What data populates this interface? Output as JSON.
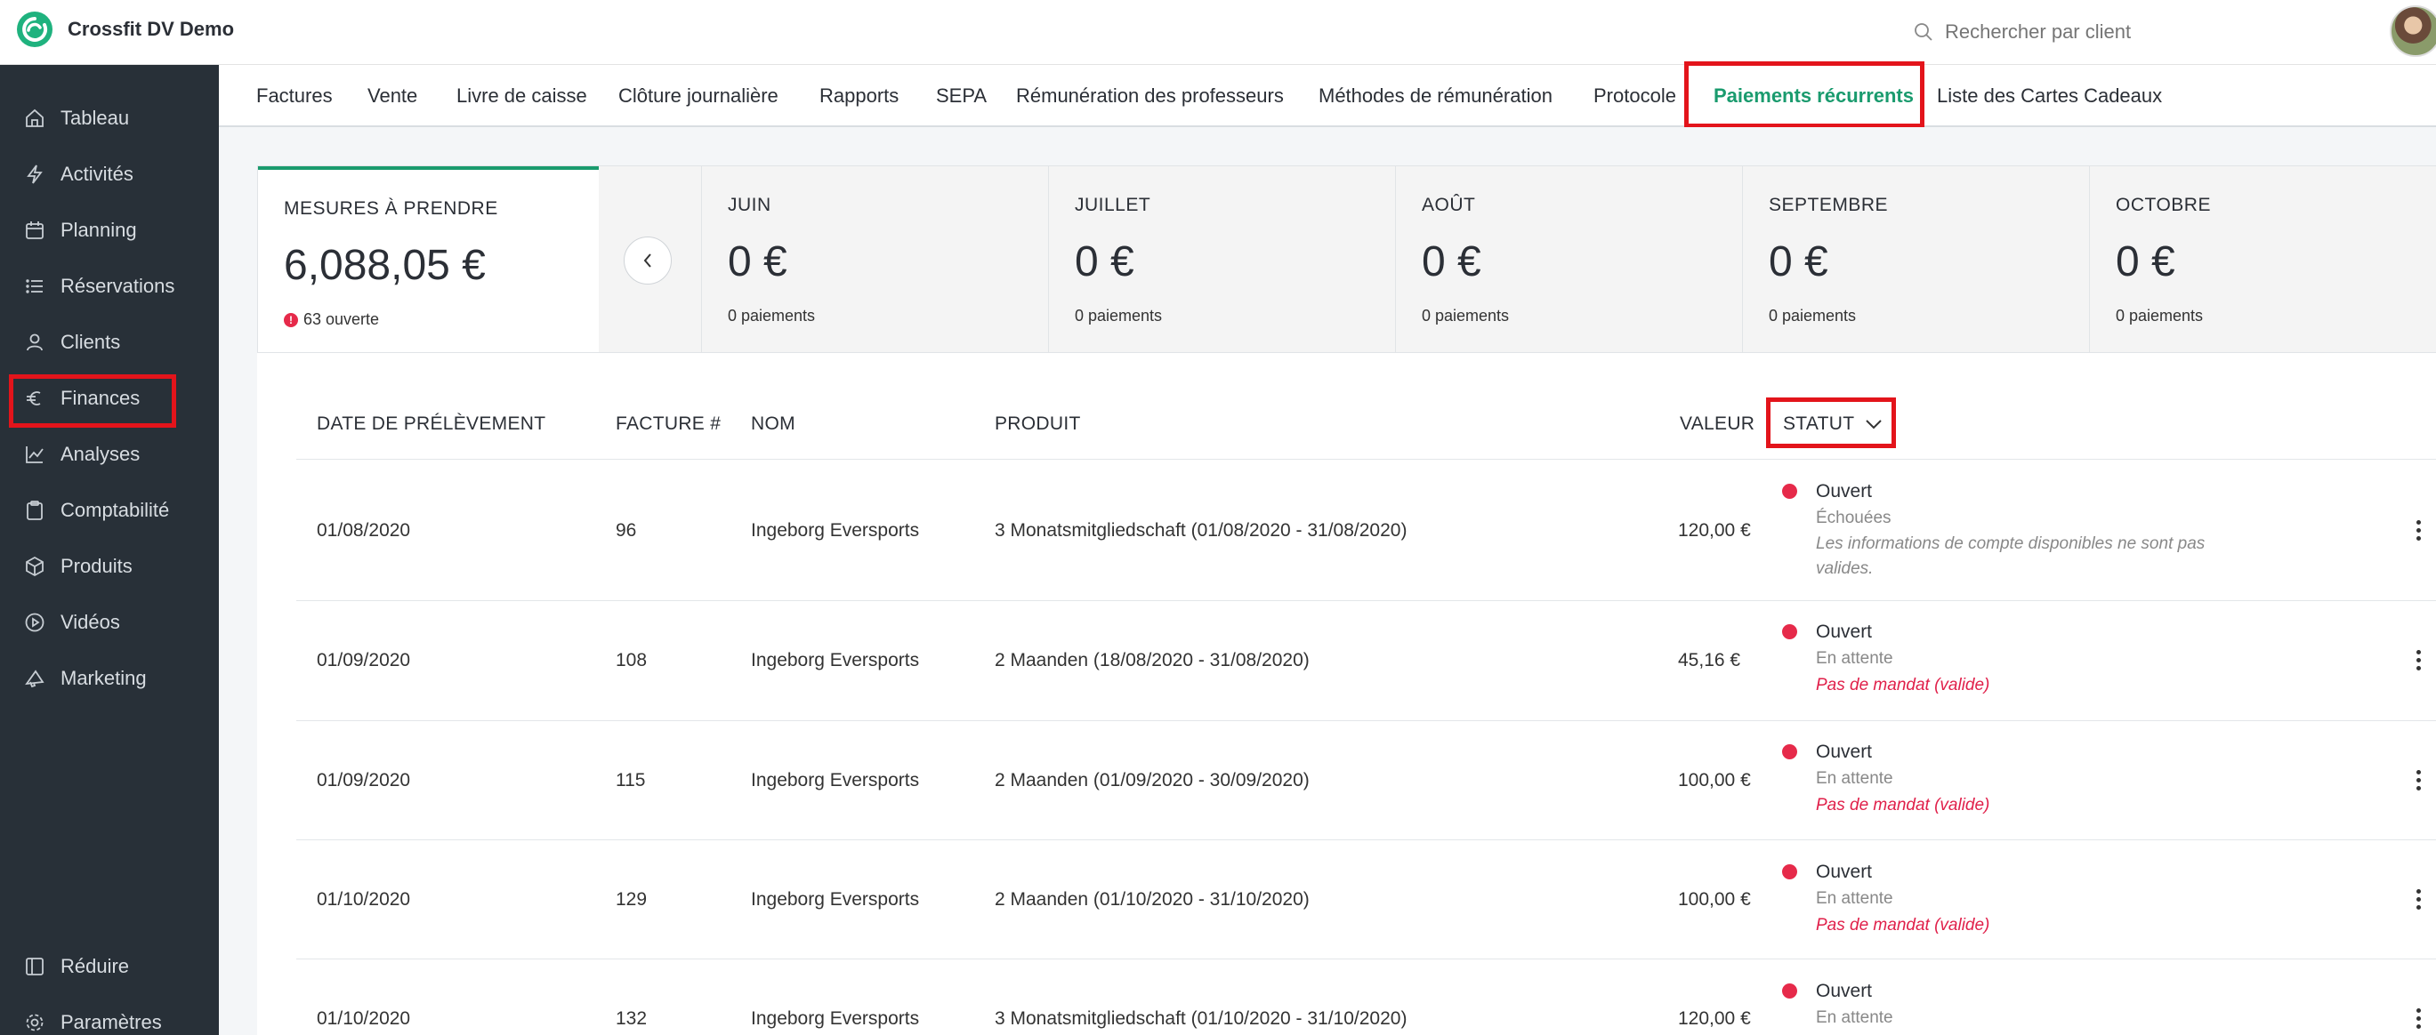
{
  "app": {
    "name": "Crossfit DV Demo"
  },
  "search": {
    "placeholder": "Rechercher par client"
  },
  "sidebar": {
    "items": [
      {
        "label": "Tableau",
        "icon": "home-icon"
      },
      {
        "label": "Activités",
        "icon": "lightning-icon"
      },
      {
        "label": "Planning",
        "icon": "calendar-icon"
      },
      {
        "label": "Réservations",
        "icon": "list-icon"
      },
      {
        "label": "Clients",
        "icon": "user-icon"
      },
      {
        "label": "Finances",
        "icon": "euro-icon"
      },
      {
        "label": "Analyses",
        "icon": "chart-line-icon"
      },
      {
        "label": "Comptabilité",
        "icon": "clipboard-icon"
      },
      {
        "label": "Produits",
        "icon": "box-icon"
      },
      {
        "label": "Vidéos",
        "icon": "play-icon"
      },
      {
        "label": "Marketing",
        "icon": "megaphone-icon"
      }
    ],
    "bottom": [
      {
        "label": "Réduire",
        "icon": "collapse-icon"
      },
      {
        "label": "Paramètres",
        "icon": "gear-icon"
      }
    ]
  },
  "tabs": [
    "Factures",
    "Vente",
    "Livre de caisse",
    "Clôture journalière",
    "Rapports",
    "SEPA",
    "Rémunération des professeurs",
    "Méthodes de rémunération",
    "Protocole",
    "Paiements récurrents",
    "Liste des Cartes Cadeaux"
  ],
  "active_tab": "Paiements récurrents",
  "summary": {
    "main": {
      "title": "MESURES À PRENDRE",
      "value": "6,088,05 €",
      "sub": "63 ouverte"
    },
    "months": [
      {
        "title": "JUIN",
        "value": "0 €",
        "sub": "0 paiements"
      },
      {
        "title": "JUILLET",
        "value": "0 €",
        "sub": "0 paiements"
      },
      {
        "title": "AOÛT",
        "value": "0 €",
        "sub": "0 paiements"
      },
      {
        "title": "SEPTEMBRE",
        "value": "0 €",
        "sub": "0 paiements"
      },
      {
        "title": "OCTOBRE",
        "value": "0 €",
        "sub": "0 paiements"
      }
    ]
  },
  "table": {
    "headers": {
      "date": "DATE DE PRÉLÈVEMENT",
      "invoice": "FACTURE #",
      "name": "NOM",
      "product": "PRODUIT",
      "value": "VALEUR",
      "status": "STATUT"
    },
    "rows": [
      {
        "date": "01/08/2020",
        "invoice": "96",
        "name": "Ingeborg Eversports",
        "product": "3 Monatsmitgliedschaft (01/08/2020 - 31/08/2020)",
        "value": "120,00 €",
        "status": "Ouvert",
        "state": "Échouées",
        "note": "Les informations de compte disponibles ne sont pas valides."
      },
      {
        "date": "01/09/2020",
        "invoice": "108",
        "name": "Ingeborg Eversports",
        "product": "2 Maanden (18/08/2020 - 31/08/2020)",
        "value": "45,16 €",
        "status": "Ouvert",
        "state": "En attente",
        "note": "Pas de mandat (valide)"
      },
      {
        "date": "01/09/2020",
        "invoice": "115",
        "name": "Ingeborg Eversports",
        "product": "2 Maanden (01/09/2020 - 30/09/2020)",
        "value": "100,00 €",
        "status": "Ouvert",
        "state": "En attente",
        "note": "Pas de mandat (valide)"
      },
      {
        "date": "01/10/2020",
        "invoice": "129",
        "name": "Ingeborg Eversports",
        "product": "2 Maanden (01/10/2020 - 31/10/2020)",
        "value": "100,00 €",
        "status": "Ouvert",
        "state": "En attente",
        "note": "Pas de mandat (valide)"
      },
      {
        "date": "01/10/2020",
        "invoice": "132",
        "name": "Ingeborg Eversports",
        "product": "3 Monatsmitgliedschaft (01/10/2020 - 31/10/2020)",
        "value": "120,00 €",
        "status": "Ouvert",
        "state": "En attente",
        "note": ""
      }
    ]
  },
  "colors": {
    "accent": "#1a9b6e",
    "sidebar": "#283038",
    "status_red": "#e62a4a",
    "highlight": "#e3141b"
  }
}
